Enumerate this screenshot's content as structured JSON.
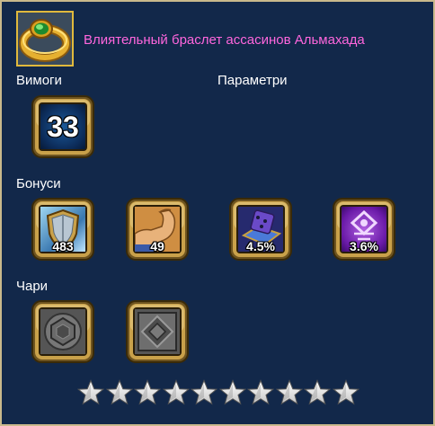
{
  "item": {
    "name": "Влиятельный браслет ассасинов Альмахада",
    "icon": "gold-bracelet-green-gem-icon"
  },
  "sections": {
    "requirements": "Вимоги",
    "parameters": "Параметри",
    "bonuses": "Бонуси",
    "charms": "Чари"
  },
  "requirements": {
    "level": "33"
  },
  "bonuses": [
    {
      "icon": "shield-icon",
      "value": "483"
    },
    {
      "icon": "strength-arm-icon",
      "value": "49"
    },
    {
      "icon": "dice-book-icon",
      "value": "4.5%"
    },
    {
      "icon": "purple-rune-icon",
      "value": "3.6%"
    }
  ],
  "charms": [
    {
      "icon": "empty-charm-slot-round-icon"
    },
    {
      "icon": "empty-charm-slot-diamond-icon"
    }
  ],
  "stars": {
    "filled": 0,
    "total": 10
  },
  "colors": {
    "background": "#12284a",
    "title": "#ff66dd",
    "frame_gold": "#c9a14a",
    "border": "#c9b98c"
  }
}
